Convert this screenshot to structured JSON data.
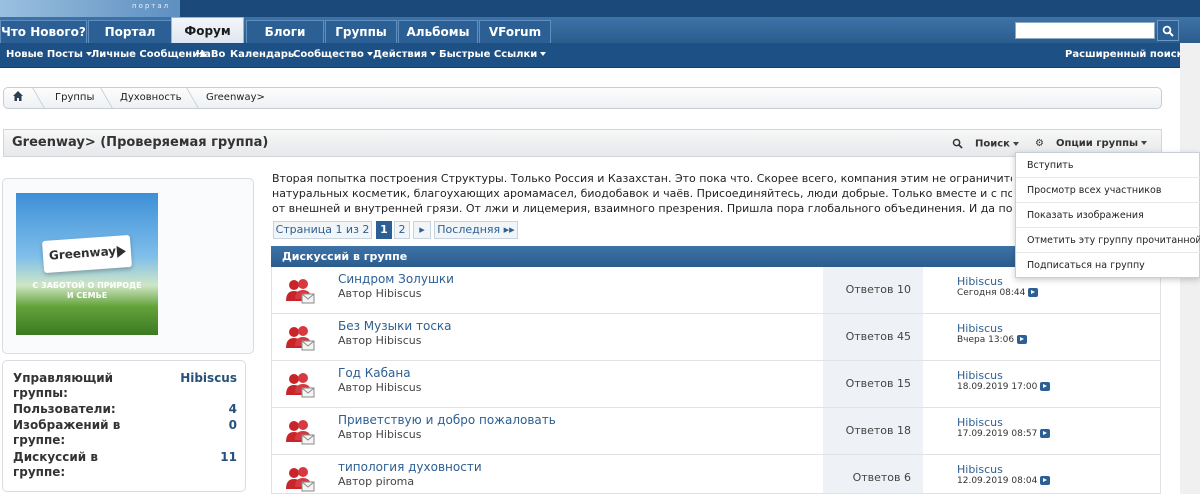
{
  "nav": {
    "tabs": [
      "Что Нового?",
      "Портал",
      "Форум",
      "Блоги",
      "Группы",
      "Альбомы",
      "VForum"
    ],
    "active_tab": "Форум",
    "banner_text": "портал"
  },
  "subnav": {
    "items": [
      "Новые Посты",
      "Личные Сообщения",
      "ЧаВо",
      "Календарь",
      "Сообщество",
      "Действия",
      "Быстрые Ссылки"
    ],
    "advanced_search": "Расширенный поиск"
  },
  "breadcrumb": [
    "Группы",
    "Духовность",
    "Greenway>"
  ],
  "group": {
    "title": "Greenway> (Проверяемая группа)",
    "search_label": "Поиск",
    "options_label": "Опции группы",
    "logo_text": "Greenway",
    "logo_slogan_1": "С ЗАБОТОЙ О ПРИРОДЕ",
    "logo_slogan_2": "И СЕМЬЕ",
    "description": [
      "Вторая попытка построения Структуры. Только Россия и Казахстан. Это пока что. Скорее всего, компания этим не ограничится. Но",
      "натуральных косметик, благоухающих аромамасел, биодобавок и чаёв. Присоединяйтесь, люди добрые. Только вместе и с понима",
      "от внешней и внутренней грязи. От лжи и лицемерия, взаимного презрения. Пришла пора глобального объединения. И да поможе"
    ]
  },
  "stats": {
    "manager_label": "Управляющий группы:",
    "manager_value": "Hibiscus",
    "users_label": "Пользователи:",
    "users_value": "4",
    "images_label": "Изображений в группе:",
    "images_value": "0",
    "discussions_label": "Дискуссий в группе:",
    "discussions_value": "11"
  },
  "pager": {
    "page_info": "Страница 1 из 2",
    "pages": [
      "1",
      "2"
    ],
    "current": "1",
    "next_icon": "▸",
    "last_label": "Последняя ▸▸"
  },
  "discussions": {
    "header": "Дискуссий в группе",
    "rows": [
      {
        "title": "Синдром Золушки",
        "author": "Автор Hibiscus",
        "replies": "Ответов 10",
        "last_user": "Hibiscus",
        "last_date": "Сегодня 08:44"
      },
      {
        "title": "Без Музыки тоска",
        "author": "Автор Hibiscus",
        "replies": "Ответов 45",
        "last_user": "Hibiscus",
        "last_date": "Вчера 13:06"
      },
      {
        "title": "Год Кабана",
        "author": "Автор Hibiscus",
        "replies": "Ответов 15",
        "last_user": "Hibiscus",
        "last_date": "18.09.2019 17:00"
      },
      {
        "title": "Приветствую и добро пожаловать",
        "author": "Автор Hibiscus",
        "replies": "Ответов 18",
        "last_user": "Hibiscus",
        "last_date": "17.09.2019 08:57"
      },
      {
        "title": "типология духовности",
        "author": "Автор piroma",
        "replies": "Ответов 6",
        "last_user": "Hibiscus",
        "last_date": "12.09.2019 08:04"
      }
    ]
  },
  "options_menu": {
    "items": [
      "Вступить",
      "Просмотр всех участников",
      "Показать изображения",
      "Отметить эту группу прочитанной",
      "Подписаться на группу"
    ]
  },
  "colors": {
    "nav": "#2b5c8e",
    "subnav": "#1d5185",
    "link": "#2c5f94",
    "icon_red": "#c8252b"
  }
}
